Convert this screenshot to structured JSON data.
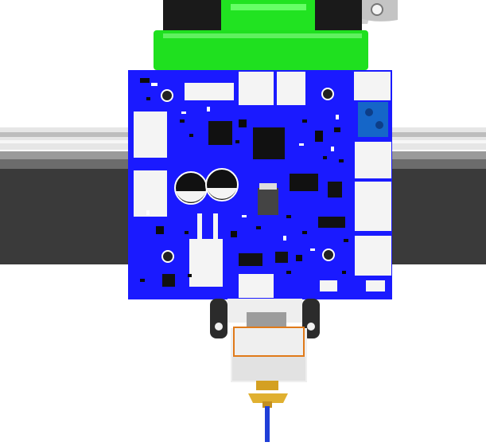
{
  "scene": {
    "description_labels": [],
    "colors": {
      "background": "#ffffff",
      "rail_light": "#d9d9d9",
      "rail_dark": "#3a3a3a",
      "pcb_blue": "#1a1aff",
      "mount_green": "#1fe01f",
      "fan_black": "#1a1a1a",
      "connector_white": "#f4f4f4",
      "terminal_blue": "#1566c8",
      "ic_black": "#111111",
      "nozzle_brass": "#e0b030",
      "filament_blue": "#1f3fd8",
      "selection_orange": "#e07a1a"
    },
    "icons": [
      "fan-icon",
      "pcb-board",
      "terminal-block-icon",
      "capacitor-icon",
      "heater-block-icon",
      "nozzle-icon"
    ]
  }
}
